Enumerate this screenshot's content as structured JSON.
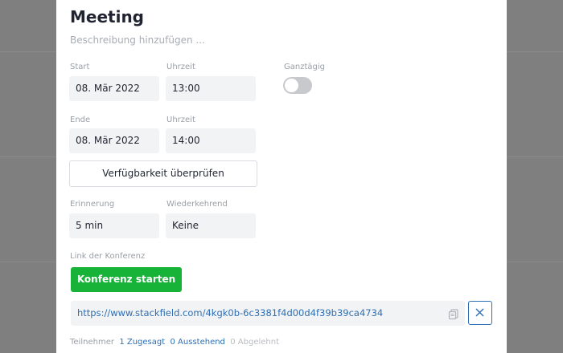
{
  "meeting": {
    "title": "Meeting",
    "description_placeholder": "Beschreibung hinzufügen ...",
    "start": {
      "label": "Start",
      "date": "08. Mär 2022",
      "time_label": "Uhrzeit",
      "time": "13:00"
    },
    "all_day": {
      "label": "Ganztägig",
      "on": false
    },
    "end": {
      "label": "Ende",
      "date": "08. Mär 2022",
      "time_label": "Uhrzeit",
      "time": "14:00"
    },
    "availability_button": "Verfügbarkeit überprüfen",
    "reminder": {
      "label": "Erinnerung",
      "value": "5 min"
    },
    "recurring": {
      "label": "Wiederkehrend",
      "value": "Keine"
    },
    "conference": {
      "label": "Link der Konferenz",
      "start_button": "Konferenz starten",
      "url": "https://www.stackfield.com/4kgk0b-6c3381f4d00d4f39b39ca4734"
    },
    "participants": {
      "label": "Teilnehmer",
      "accepted": "1 Zugesagt",
      "pending": "0 Ausstehend",
      "declined": "0 Abgelehnt"
    }
  },
  "icons": {
    "copy": "copy-icon",
    "close": "close-icon"
  },
  "colors": {
    "accent": "#2f6fb3",
    "primary_button": "#16b338",
    "backdrop": "#7f7f7f"
  }
}
